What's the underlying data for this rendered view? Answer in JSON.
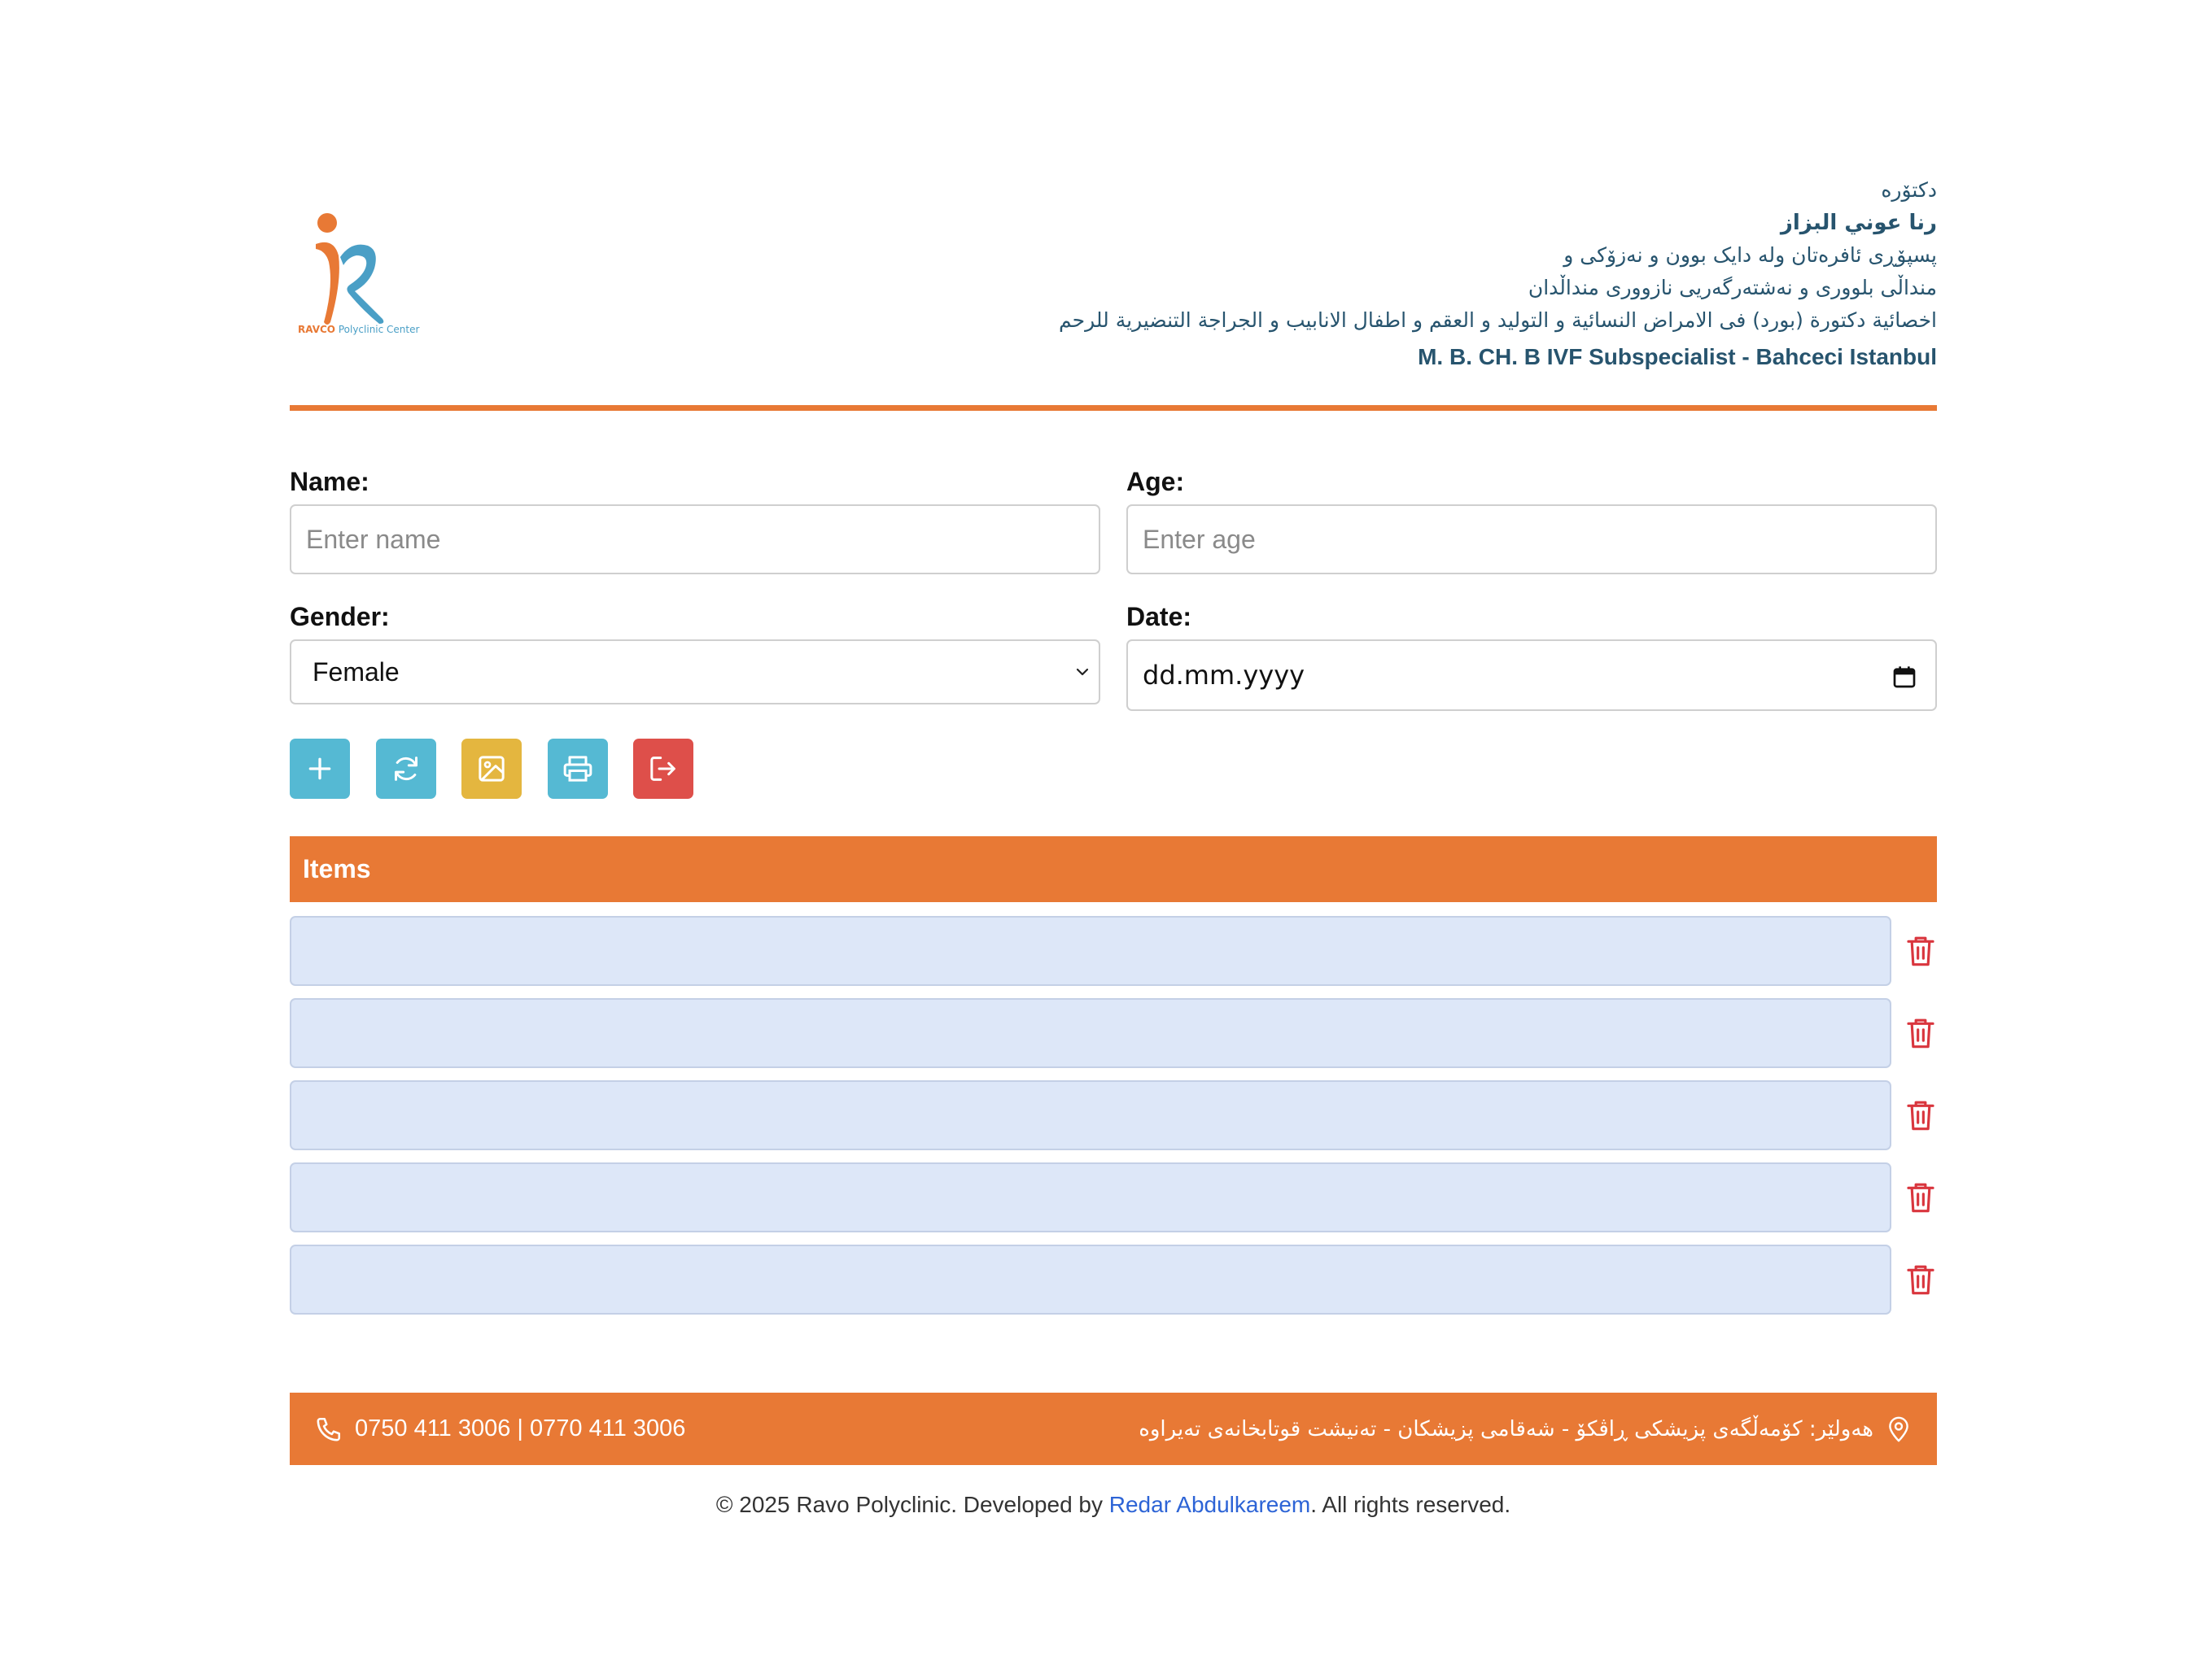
{
  "header": {
    "logo_brand": "RAVCO",
    "logo_sub": "Polyclinic Center",
    "doctor_title": "دکتۆرە",
    "doctor_name": "رنا عوني البزاز",
    "specialty_ku_1": "پسپۆڕی ئافرەتان ولە دایک بوون و نەزۆکی و",
    "specialty_ku_2": "منداڵی بلووری و نەشتەرگەریی نازووری منداڵدان",
    "specialty_ar": "اخصائية دكتورة (بورد) فی الامراض النسائية و التوليد و العقم و اطفال الانابيب و الجراجة التنضيرية للرحم",
    "credentials_en": "M. B. CH. B IVF Subspecialist - Bahceci Istanbul",
    "accent_color": "#e87935",
    "text_color": "#27546e"
  },
  "form": {
    "name_label": "Name:",
    "name_placeholder": "Enter name",
    "age_label": "Age:",
    "age_placeholder": "Enter age",
    "gender_label": "Gender:",
    "gender_value": "Female",
    "date_label": "Date:",
    "date_value": "dd.mm.yyyy"
  },
  "actions": [
    {
      "name": "add",
      "icon": "plus-icon",
      "color": "#55b9d3"
    },
    {
      "name": "refresh",
      "icon": "refresh-icon",
      "color": "#55b9d3"
    },
    {
      "name": "image",
      "icon": "image-icon",
      "color": "#e4b63f"
    },
    {
      "name": "print",
      "icon": "printer-icon",
      "color": "#55b9d3"
    },
    {
      "name": "logout",
      "icon": "logout-icon",
      "color": "#de4f4a"
    }
  ],
  "items": {
    "title": "Items",
    "rows": [
      "",
      "",
      "",
      "",
      ""
    ],
    "row_color": "#dde7f8",
    "delete_icon": "trash-icon"
  },
  "footer": {
    "phones": "0750 411 3006 | 0770 411 3006",
    "address": "هەولێر: کۆمەڵگەی پزیشکی ڕاڤکۆ - شەقامی پزیشکان - تەنیشت قوتابخانەی تەیراوە",
    "copyright_prefix": "© 2025 Ravo Polyclinic. Developed by ",
    "developer": "Redar Abdulkareem",
    "copyright_suffix": ". All rights reserved."
  }
}
